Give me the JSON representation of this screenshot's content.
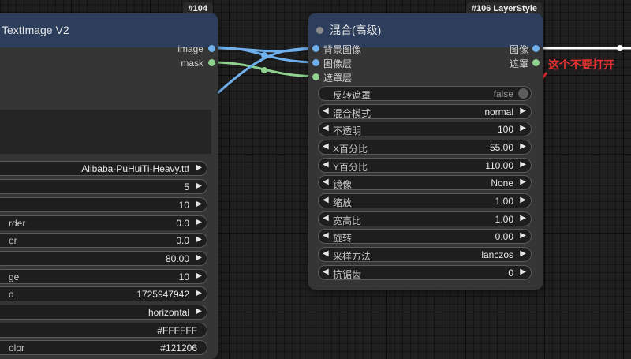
{
  "left_node": {
    "badge": "#104",
    "title": "TextImage V2",
    "outputs": [
      {
        "label": "image",
        "color": "#6fb0ec"
      },
      {
        "label": "mask",
        "color": "#8fd28f"
      }
    ],
    "widgets": [
      {
        "label": "",
        "value": "Alibaba-PuHuiTi-Heavy.ttf"
      },
      {
        "label": "",
        "value": "5"
      },
      {
        "label": "",
        "value": "10"
      },
      {
        "label": "rder",
        "value": "0.0"
      },
      {
        "label": "er",
        "value": "0.0"
      },
      {
        "label": "",
        "value": "80.00"
      },
      {
        "label": "ge",
        "value": "10"
      },
      {
        "label": "d",
        "value": "1725947942"
      },
      {
        "label": "",
        "value": "horizontal"
      },
      {
        "label": "",
        "value": "#FFFFFF"
      },
      {
        "label": "olor",
        "value": "#121206"
      }
    ]
  },
  "right_node": {
    "badge": "#106 LayerStyle",
    "title": "混合(高级)",
    "inputs": [
      {
        "label": "背景图像",
        "color": "#6fb0ec"
      },
      {
        "label": "图像层",
        "color": "#6fb0ec"
      },
      {
        "label": "遮罩层",
        "color": "#8fd28f"
      }
    ],
    "outputs": [
      {
        "label": "图像",
        "color": "#6fb0ec"
      },
      {
        "label": "遮罩",
        "color": "#8fd28f"
      }
    ],
    "toggle": {
      "label": "反转遮罩",
      "value": "false"
    },
    "widgets": [
      {
        "label": "混合模式",
        "value": "normal"
      },
      {
        "label": "不透明",
        "value": "100"
      },
      {
        "label": "X百分比",
        "value": "55.00"
      },
      {
        "label": "Y百分比",
        "value": "110.00"
      },
      {
        "label": "镜像",
        "value": "None"
      },
      {
        "label": "缩放",
        "value": "1.00"
      },
      {
        "label": "宽高比",
        "value": "1.00"
      },
      {
        "label": "旋转",
        "value": "0.00"
      },
      {
        "label": "采样方法",
        "value": "lanczos"
      },
      {
        "label": "抗锯齿",
        "value": "0"
      }
    ]
  },
  "annotation": {
    "text": "这个不要打开",
    "color": "#e8312f"
  }
}
